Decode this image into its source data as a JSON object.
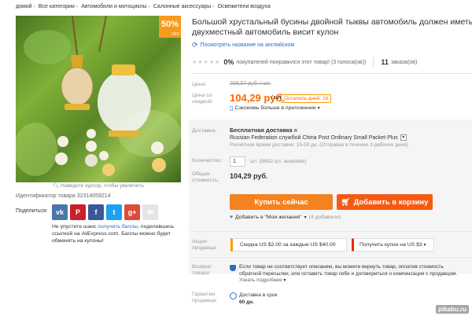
{
  "breadcrumb": [
    "домой",
    "Все категории",
    "Автомобили и мотоциклы",
    "Салонные аксессуары",
    "Освежители воздуха"
  ],
  "gallery": {
    "badge_value": "50",
    "badge_suffix": "%",
    "badge_off": "OFF",
    "zoom_hint": "Наведите курсор, чтобы увеличить",
    "product_id": "Идентификатор товара 32314059214"
  },
  "share": {
    "label": "Поделиться:",
    "icons": [
      {
        "name": "vk-icon",
        "glyph": "vk",
        "color": "#4a76a8"
      },
      {
        "name": "pinterest-icon",
        "glyph": "P",
        "color": "#cb2027"
      },
      {
        "name": "facebook-icon",
        "glyph": "f",
        "color": "#3b5998"
      },
      {
        "name": "twitter-icon",
        "glyph": "t",
        "color": "#1da1f2"
      },
      {
        "name": "google-plus-icon",
        "glyph": "g+",
        "color": "#dd4b39"
      },
      {
        "name": "email-icon",
        "glyph": "✉",
        "color": "#e5e5e5"
      }
    ],
    "bonus_prefix": "Не упустите шанс ",
    "bonus_link": "получить баллы",
    "bonus_suffix": ", поделившись ссылкой на AliExpress.com. Баллы можно будет обменять на купоны!"
  },
  "product": {
    "title_line1": "Большой хрустальный бусины двойной тыквы автомобиль должен иметь",
    "title_line2": "двухместный автомобиль висит кулон",
    "translate_link": "Посмотреть название на английском"
  },
  "rating": {
    "stars": "★★★★★",
    "percent": "0%",
    "liked_text": "покупателей понравился этот товар! (3 голоса(ов))",
    "orders_count": "11",
    "orders_label": "заказа(ов)"
  },
  "price": {
    "label_old": "Цена:",
    "old_value": "208,57 руб. / шт.",
    "label_discount": "Цена со скидкой:",
    "new_value": "104,29 руб.",
    "unit": "/ шт.",
    "days_left": "Осталось дней: 16",
    "app_save": "Сэкономь больше в приложении"
  },
  "shipping": {
    "label": "Доставка:",
    "title": "Бесплатная доставка",
    "title_suffix": "в",
    "method": "Russian Federation службой China Post Ordinary Small Packet Plus",
    "time": "Расчётное время доставки: 15-50 дн. (Отправка в течение 3 рабочих дней)"
  },
  "quantity": {
    "label": "Количество:",
    "value": "1",
    "unit": "шт.",
    "available": "(9992 шт. available)"
  },
  "total": {
    "label": "Общая стоимость:",
    "value": "104,29 руб."
  },
  "actions": {
    "buy_now": "Купить сейчас",
    "add_to_cart": "Добавить в корзину",
    "wishlist": "Добавить в \"Мои желания\"",
    "wishlist_count": "(4 добавили)"
  },
  "promo": {
    "label": "Акции продавца:",
    "discount": "Скидка US $2.00 за каждые US $40.00",
    "coupon": "Получить купон на US $3"
  },
  "returns": {
    "label": "Возврат товара:",
    "text": "Если товар не соответствует описанию, вы можете вернуть товар, оплатив стоимость обратной пересылки, или оставить товар себе и договориться о компенсации с продавцом.",
    "more": "Узнать подробнее"
  },
  "guarantee": {
    "label": "Гарантии продавца:",
    "line1": "Доставка в срок",
    "line2": "60 дн."
  },
  "watermark": "pikabu.ru",
  "colors": {
    "accent": "#f60",
    "link": "#2b6dc4",
    "buy": "#f58220",
    "cart": "#f55a12"
  }
}
